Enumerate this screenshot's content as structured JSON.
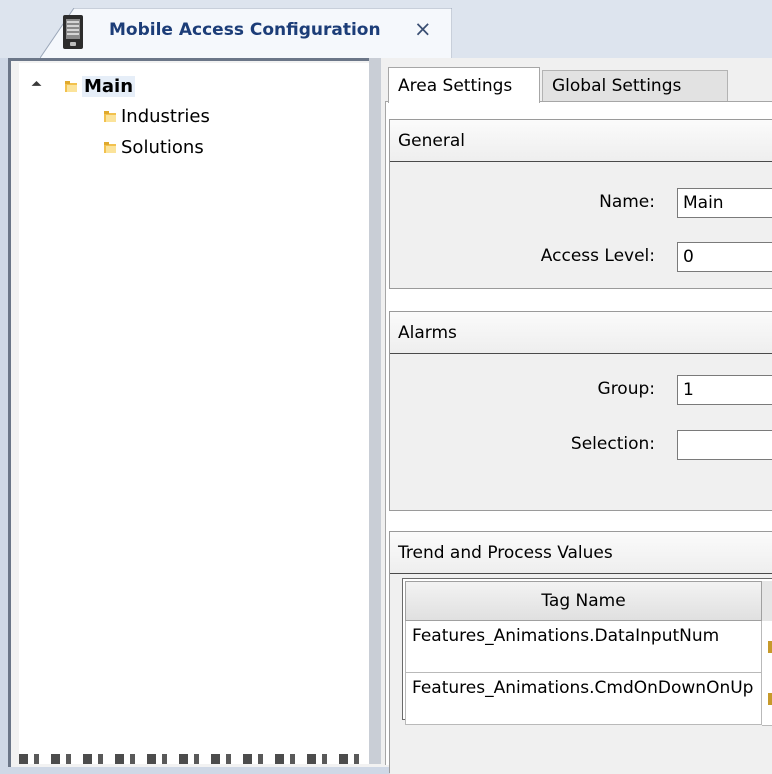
{
  "document_tab": {
    "title": "Mobile Access Configuration",
    "close_glyph": "×",
    "icon": "mobile-phone-icon"
  },
  "tree": {
    "expander_glyph": "◢",
    "folder_icon": "folder-icon",
    "items": [
      {
        "label": "Main",
        "level": 0,
        "expanded": true,
        "selected": true
      },
      {
        "label": "Industries",
        "level": 1
      },
      {
        "label": "Solutions",
        "level": 1
      }
    ]
  },
  "tabs": [
    {
      "label": "Area Settings",
      "active": true
    },
    {
      "label": "Global Settings",
      "active": false
    }
  ],
  "general": {
    "header": "General",
    "name_label": "Name:",
    "name_value": "Main",
    "access_level_label": "Access Level:",
    "access_level_value": "0"
  },
  "alarms": {
    "header": "Alarms",
    "group_label": "Group:",
    "group_value": "1",
    "selection_label": "Selection:",
    "selection_value": ""
  },
  "trend": {
    "header": "Trend and Process Values",
    "column_tag_name": "Tag Name",
    "rows": [
      {
        "tag_name": "Features_Animations.DataInputNum"
      },
      {
        "tag_name": "Features_Animations.CmdOnDownOnUp"
      }
    ]
  },
  "colors": {
    "tab_title": "#1c3d78",
    "folder": "#f2c14e",
    "tree_background": "#ffffff",
    "panel_background": "#f0f0f0"
  }
}
